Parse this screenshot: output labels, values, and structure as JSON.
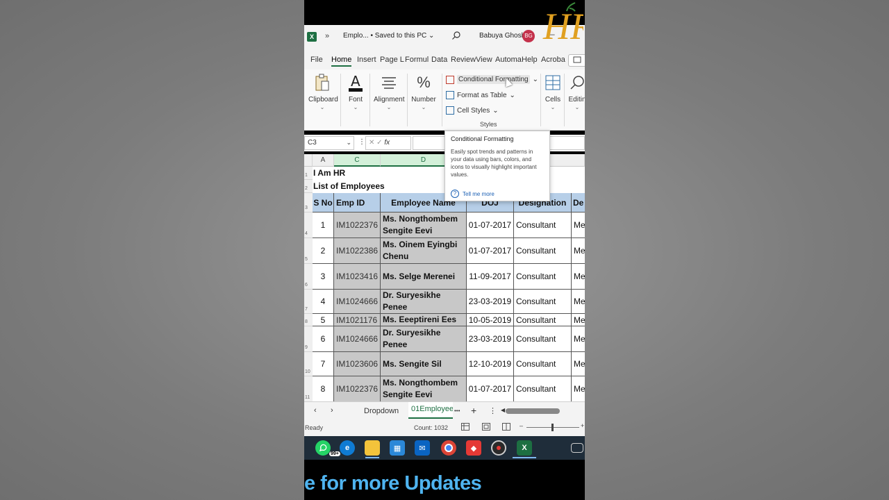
{
  "window": {
    "app_icon": "X",
    "overflow_chevron": "»",
    "document_title": "Emplo... • Saved to this PC",
    "user_name": "Babuya Ghosh",
    "user_initials": "BG",
    "minimize_glyph": "–"
  },
  "watermark": {
    "text": "HR"
  },
  "ribbon_tabs": [
    "File",
    "Home",
    "Insert",
    "Page L",
    "Formul",
    "Data",
    "Review",
    "View",
    "Automa",
    "Help",
    "Acroba"
  ],
  "ribbon": {
    "clipboard": "Clipboard",
    "font": "Font",
    "alignment": "Alignment",
    "number": "Number",
    "number_glyph": "%",
    "conditional_formatting": "Conditional Formatting",
    "format_as_table": "Format as Table",
    "cell_styles": "Cell Styles",
    "styles": "Styles",
    "cells": "Cells",
    "editing": "Editin"
  },
  "formula_bar": {
    "name_box": "C3",
    "fx": "fx"
  },
  "tooltip": {
    "title": "Conditional Formatting",
    "body": "Easily spot trends and patterns in your data using bars, colors, and icons to visually highlight important values.",
    "link": "Tell me more",
    "help_glyph": "?"
  },
  "columns": [
    "A",
    "C",
    "D"
  ],
  "sheet": {
    "title_line1": "I Am HR",
    "title_line2": "List of Employees",
    "headers": [
      "S No",
      "Emp ID",
      "Employee Name",
      "DOJ",
      "Designation",
      "De"
    ],
    "rows": [
      {
        "sno": "1",
        "id": "IM1022376",
        "name": "Ms. Nongthombem Sengite Eevi",
        "doj": "01-07-2017",
        "desig": "Consultant",
        "dept": "Me"
      },
      {
        "sno": "2",
        "id": "IM1022386",
        "name": "Ms. Oinem Eyingbi Chenu",
        "doj": "01-07-2017",
        "desig": "Consultant",
        "dept": "Me"
      },
      {
        "sno": "3",
        "id": "IM1023416",
        "name": "Ms. Selge Merenei",
        "doj": "11-09-2017",
        "desig": "Consultant",
        "dept": "Me"
      },
      {
        "sno": "4",
        "id": "IM1024666",
        "name": "Dr. Suryesikhe Penee",
        "doj": "23-03-2019",
        "desig": "Consultant",
        "dept": "Me"
      },
      {
        "sno": "5",
        "id": "IM1021176",
        "name": "Ms. Eeeptireni Ees",
        "doj": "10-05-2019",
        "desig": "Consultant",
        "dept": "Me"
      },
      {
        "sno": "6",
        "id": "IM1024666",
        "name": "Dr. Suryesikhe Penee",
        "doj": "23-03-2019",
        "desig": "Consultant",
        "dept": "Me"
      },
      {
        "sno": "7",
        "id": "IM1023606",
        "name": "Ms. Sengite Sil",
        "doj": "12-10-2019",
        "desig": "Consultant",
        "dept": "Me"
      },
      {
        "sno": "8",
        "id": "IM1022376",
        "name": "Ms. Nongthombem Sengite Eevi",
        "doj": "01-07-2017",
        "desig": "Consultant",
        "dept": "Me"
      }
    ],
    "row_numbers": [
      "1",
      "2",
      "3",
      "4",
      "5",
      "6",
      "7",
      "8",
      "9",
      "10",
      "11"
    ]
  },
  "sheet_tabs": {
    "prev": "‹",
    "next": "›",
    "inactive": "Dropdown",
    "active": "01Employee",
    "more": "•••",
    "add": "+",
    "options": "⋮"
  },
  "status_bar": {
    "status": "Ready",
    "count": "Count: 1032",
    "zoom_minus": "–",
    "zoom_plus": "+"
  },
  "taskbar": {
    "whatsapp_badge": "99+",
    "excel_letter": "X"
  },
  "caption": "e for more Updates",
  "colors": {
    "excel_green": "#1d6f42",
    "header_blue": "#b7cfe8",
    "caption_blue": "#4fb4f0"
  }
}
